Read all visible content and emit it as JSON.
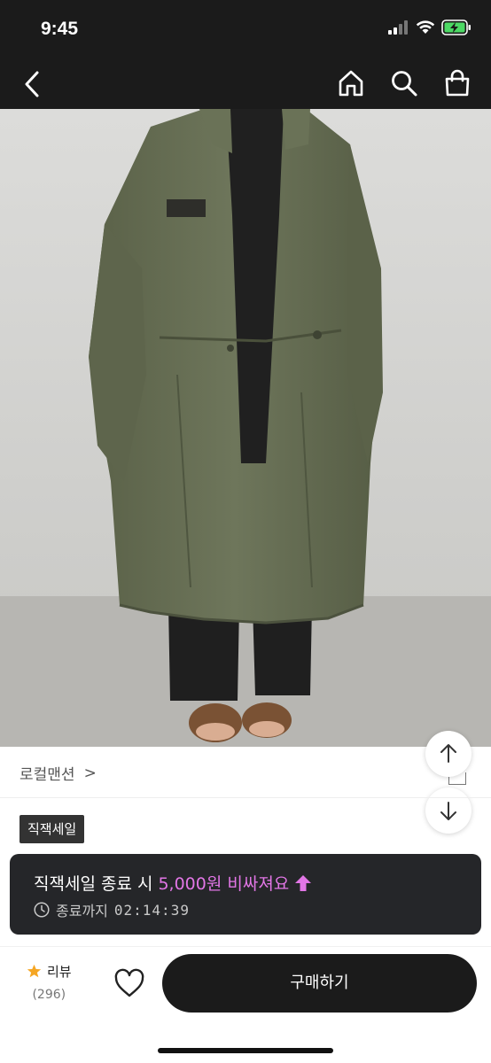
{
  "status_bar": {
    "time": "9:45",
    "icons": [
      "signal-icon",
      "wifi-icon",
      "battery-charging-icon"
    ]
  },
  "nav": {
    "icons": [
      "back-icon",
      "home-icon",
      "search-icon",
      "shopping-bag-icon"
    ]
  },
  "product": {
    "image_description_icon": "product-photo",
    "shop_name": "로컬맨션",
    "shop_chevron": ">",
    "sale_tag": "직잭세일"
  },
  "sale_banner": {
    "prefix": "직잭세일 종료 시",
    "highlight": "5,000원 비싸져요",
    "countdown_label": "종료까지",
    "countdown": "02:14:39"
  },
  "bottom_bar": {
    "review_label": "리뷰",
    "review_count": "(296)",
    "buy_label": "구매하기"
  },
  "colors": {
    "dark": "#1b1b1b",
    "banner_bg": "#252629",
    "highlight": "#e276e6",
    "star": "#f5a623",
    "battery": "#4cd964"
  }
}
